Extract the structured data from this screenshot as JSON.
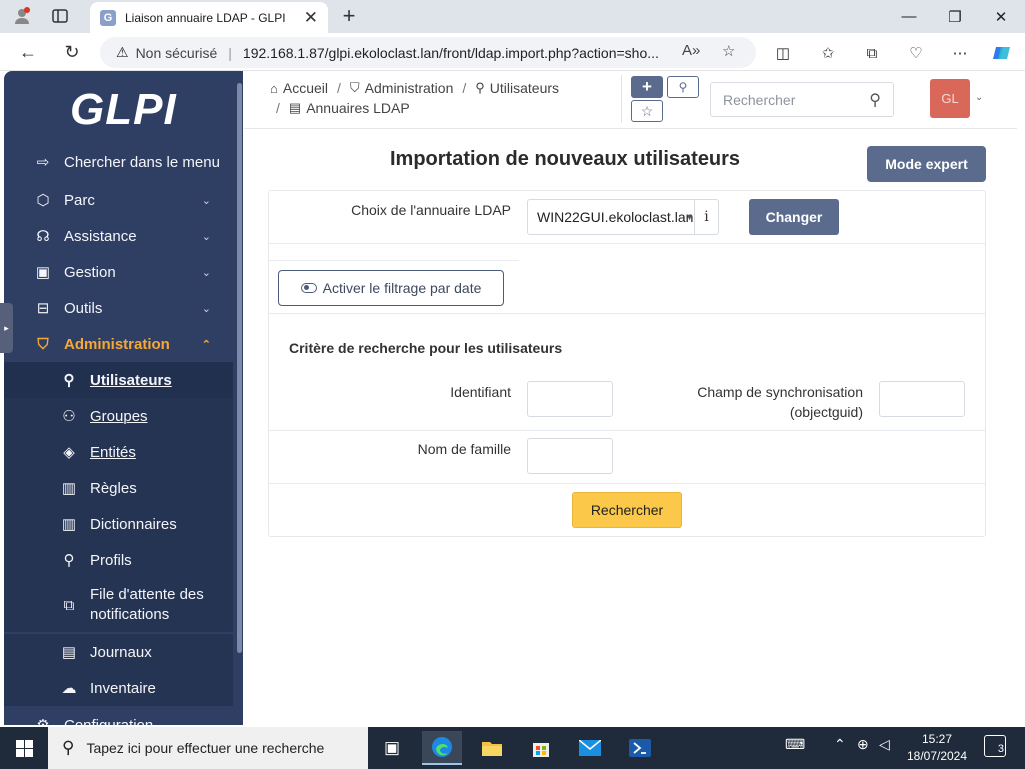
{
  "browser": {
    "tab_title": "Liaison annuaire LDAP - GLPI",
    "tab_favicon": "G",
    "security": "Non sécurisé",
    "url": "192.168.1.87/glpi.ekoloclast.lan/front/ldap.import.php?action=sho..."
  },
  "sidebar": {
    "logo": "GLPI",
    "search_menu": "Chercher dans le menu",
    "items": [
      {
        "label": "Parc"
      },
      {
        "label": "Assistance"
      },
      {
        "label": "Gestion"
      },
      {
        "label": "Outils"
      },
      {
        "label": "Administration"
      }
    ],
    "sub_items": [
      {
        "label": "Utilisateurs"
      },
      {
        "label": "Groupes"
      },
      {
        "label": "Entités"
      },
      {
        "label": "Règles"
      },
      {
        "label": "Dictionnaires"
      },
      {
        "label": "Profils"
      },
      {
        "label": "File d'attente des notifications"
      },
      {
        "label": "Journaux"
      },
      {
        "label": "Inventaire"
      }
    ],
    "partial_item": "Configuration"
  },
  "header": {
    "breadcrumb": [
      "Accueil",
      "Administration",
      "Utilisateurs",
      "Annuaires LDAP"
    ],
    "search_placeholder": "Rechercher",
    "avatar_initials": "GL"
  },
  "main": {
    "title": "Importation de nouveaux utilisateurs",
    "expert_button": "Mode expert",
    "ldap_label": "Choix de l'annuaire LDAP",
    "ldap_value": "WIN22GUI.ekoloclast.lan",
    "info_glyph": "i",
    "change_button": "Changer",
    "date_filter_button": "Activer le filtrage par date",
    "criteria_title": "Critère de recherche pour les utilisateurs",
    "field_identifiant": "Identifiant",
    "field_sync_1": "Champ de synchronisation",
    "field_sync_2": "(objectguid)",
    "field_nom": "Nom de famille",
    "search_button": "Rechercher"
  },
  "taskbar": {
    "search_placeholder": "Tapez ici pour effectuer une recherche",
    "time": "15:27",
    "date": "18/07/2024",
    "notification_count": "3"
  },
  "colors": {
    "sidebar_bg": "#2f3f64",
    "active_accent": "#f6a836",
    "primary_button": "#5b6b8d",
    "search_button": "#fbc84a",
    "avatar_bg": "#d9685a"
  }
}
